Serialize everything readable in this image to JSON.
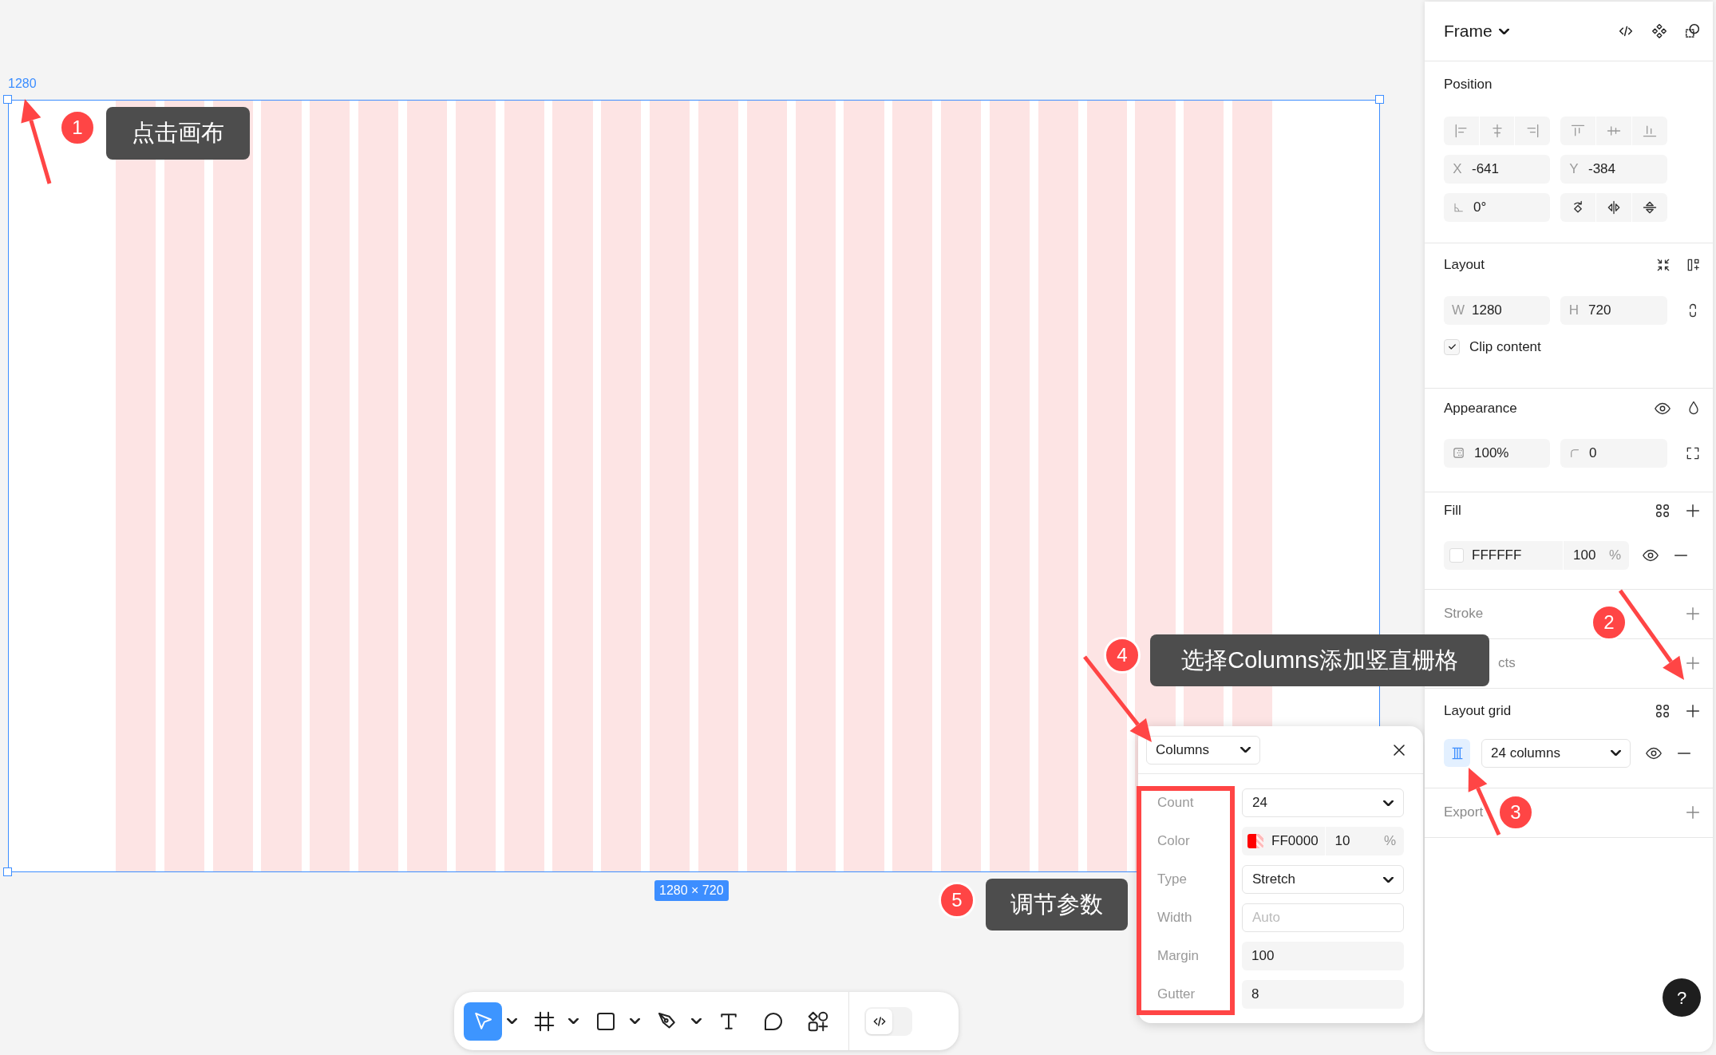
{
  "canvas": {
    "frame_width_label": "1280",
    "size_badge": "1280 × 720"
  },
  "toolbar": {
    "tools": [
      {
        "selected": true,
        "dropdown": true
      },
      {
        "selected": false,
        "dropdown": true
      },
      {
        "selected": false,
        "dropdown": true
      },
      {
        "selected": false,
        "dropdown": true
      },
      {
        "selected": false,
        "dropdown": false
      },
      {
        "selected": false,
        "dropdown": false
      },
      {
        "selected": false,
        "dropdown": false
      }
    ],
    "dev_mode": {
      "on": false
    }
  },
  "grid_popup": {
    "type": "Columns",
    "fields": [
      {
        "label": "Count",
        "kind": "select",
        "value": "24"
      },
      {
        "label": "Color",
        "kind": "color",
        "value": "FF0000",
        "opacity": "10",
        "unit": "%"
      },
      {
        "label": "Type",
        "kind": "select",
        "value": "Stretch"
      },
      {
        "label": "Width",
        "kind": "text",
        "placeholder": "Auto"
      },
      {
        "label": "Margin",
        "kind": "number",
        "value": "100"
      },
      {
        "label": "Gutter",
        "kind": "number",
        "value": "8"
      }
    ]
  },
  "panel": {
    "title": "Frame",
    "position": {
      "title": "Position",
      "x": {
        "label": "X",
        "value": "-641"
      },
      "y": {
        "label": "Y",
        "value": "-384"
      },
      "rotation": "0°"
    },
    "layout": {
      "title": "Layout",
      "w": {
        "label": "W",
        "value": "1280"
      },
      "h": {
        "label": "H",
        "value": "720"
      },
      "clip_content": {
        "label": "Clip content",
        "checked": true
      }
    },
    "appearance": {
      "title": "Appearance",
      "opacity": "100%",
      "radius": "0"
    },
    "fill": {
      "title": "Fill",
      "hex": "FFFFFF",
      "opacity": "100",
      "unit": "%"
    },
    "stroke": {
      "title": "Stroke",
      "muted": true
    },
    "effects": {
      "title": "cts",
      "muted": true
    },
    "layout_grid": {
      "title": "Layout grid",
      "muted": false,
      "grid": {
        "selected": true,
        "label": "24 columns",
        "visible": true
      }
    },
    "export": {
      "title": "Export",
      "muted": true
    },
    "help": "?"
  },
  "annotations": [
    {
      "number": "1",
      "text": "点击画布"
    },
    {
      "number": "2"
    },
    {
      "number": "3"
    },
    {
      "number": "4",
      "text": "选择Columns添加竖直栅格"
    },
    {
      "number": "5",
      "text": "调节参数"
    }
  ]
}
